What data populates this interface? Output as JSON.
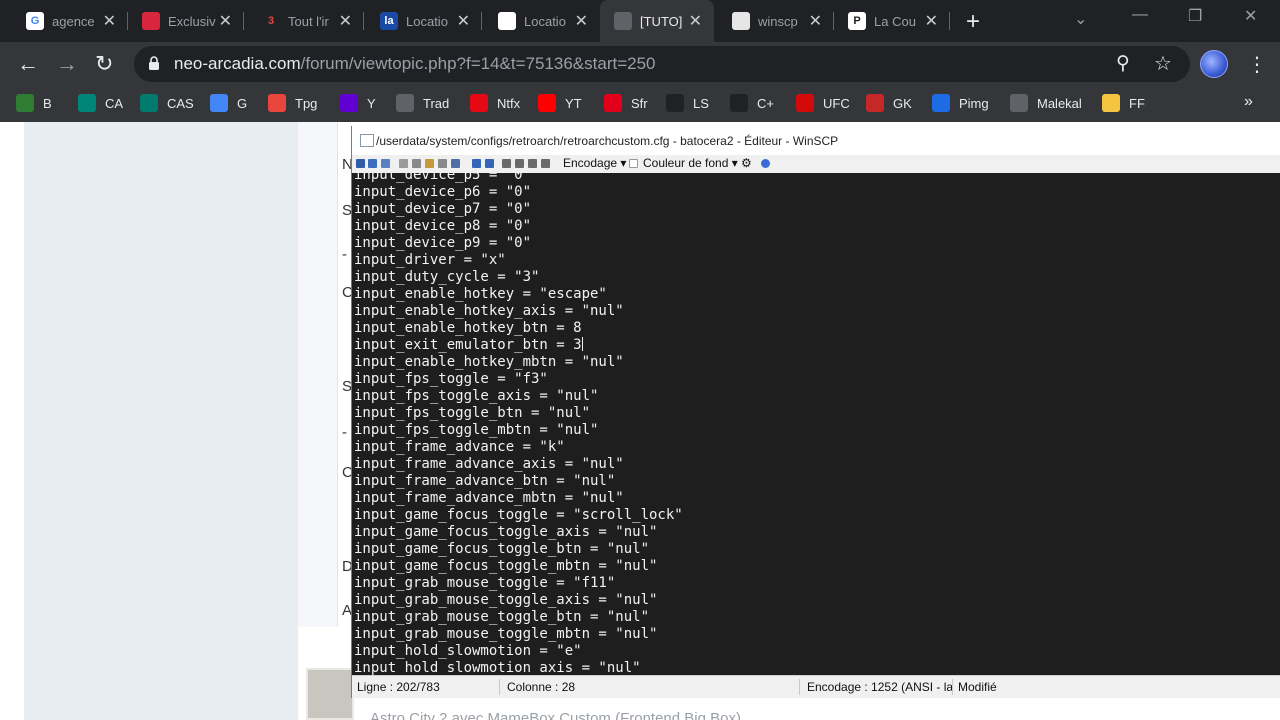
{
  "browser": {
    "tabs": [
      {
        "title": "agence",
        "favicon": "google-icon",
        "color": "#ffffff",
        "glyph": "G",
        "glyph_color": "#4285f4"
      },
      {
        "title": "Exclusiv",
        "favicon": "exclusiv-icon",
        "color": "#d9263f",
        "glyph": "",
        "glyph_color": "#ffffff"
      },
      {
        "title": "Tout l'ir",
        "favicon": "tout-icon",
        "color": "#202124",
        "glyph": "3",
        "glyph_color": "#e8453c"
      },
      {
        "title": "Locatio",
        "favicon": "lafayette-icon",
        "color": "#1a4aa6",
        "glyph": "la",
        "glyph_color": "#ffffff"
      },
      {
        "title": "Locatio",
        "favicon": "location-icon",
        "color": "#ffffff",
        "glyph": "",
        "glyph_color": "#e8453c"
      },
      {
        "title": "[TUTO]",
        "favicon": "globe-icon",
        "color": "#5f6368",
        "glyph": "",
        "glyph_color": "#e8eaed"
      },
      {
        "title": "winscp",
        "favicon": "winscp-icon",
        "color": "#e6e6e6",
        "glyph": "",
        "glyph_color": "#2c8a3a"
      },
      {
        "title": "La Cou",
        "favicon": "lacourse-icon",
        "color": "#ffffff",
        "glyph": "P",
        "glyph_color": "#202124"
      }
    ],
    "active_tab": 5,
    "url_host": "neo-arcadia.com",
    "url_path": "/forum/viewtopic.php?f=14&t=75136&start=250",
    "bookmarks": [
      {
        "label": "B",
        "icon": "headphones-icon",
        "color": "#2e7d32"
      },
      {
        "label": "CA",
        "icon": "ca-icon",
        "color": "#00857a"
      },
      {
        "label": "CAS",
        "icon": "cas-icon",
        "color": "#007a6e"
      },
      {
        "label": "G",
        "icon": "google-icon",
        "color": "#4285f4"
      },
      {
        "label": "Tpg",
        "icon": "tpg-icon",
        "color": "#e8453c"
      },
      {
        "label": "Y",
        "icon": "yahoo-icon",
        "color": "#6001d2"
      },
      {
        "label": "Trad",
        "icon": "globe-icon",
        "color": "#5f6368"
      },
      {
        "label": "Ntfx",
        "icon": "netflix-icon",
        "color": "#e50914"
      },
      {
        "label": "YT",
        "icon": "youtube-icon",
        "color": "#ff0000"
      },
      {
        "label": "Sfr",
        "icon": "sfr-icon",
        "color": "#e2001a"
      },
      {
        "label": "LS",
        "icon": "ls-icon",
        "color": "#202124"
      },
      {
        "label": "C+",
        "icon": "canalplus-icon",
        "color": "#202124"
      },
      {
        "label": "UFC",
        "icon": "ufc-icon",
        "color": "#d20a0a"
      },
      {
        "label": "GK",
        "icon": "gk-icon",
        "color": "#c62828"
      },
      {
        "label": "Pimg",
        "icon": "pimg-icon",
        "color": "#1e6be6"
      },
      {
        "label": "Malekal",
        "icon": "malekal-icon",
        "color": "#5f6368"
      },
      {
        "label": "FF",
        "icon": "folder-icon",
        "color": "#f5c542"
      }
    ]
  },
  "page": {
    "side_letters": [
      "N",
      "S",
      "-",
      "C",
      "S",
      "-",
      "C",
      "D",
      "A"
    ],
    "cut_text": "Astro City 2 avec MameBox Custom (Frontend Big Box)"
  },
  "editor": {
    "title": "/userdata/system/configs/retroarch/retroarchcustom.cfg - batocera2 - Éditeur - WinSCP",
    "toolbar": {
      "encoding_label": "Encodage",
      "bgcolor_label": "Couleur de fond"
    },
    "lines": [
      "input_device_p5 = \"0\"",
      "input_device_p6 = \"0\"",
      "input_device_p7 = \"0\"",
      "input_device_p8 = \"0\"",
      "input_device_p9 = \"0\"",
      "input_driver = \"x\"",
      "input_duty_cycle = \"3\"",
      "input_enable_hotkey = \"escape\"",
      "input_enable_hotkey_axis = \"nul\"",
      "input_enable_hotkey_btn = 8",
      "input_exit_emulator_btn = 3",
      "input_enable_hotkey_mbtn = \"nul\"",
      "input_fps_toggle = \"f3\"",
      "input_fps_toggle_axis = \"nul\"",
      "input_fps_toggle_btn = \"nul\"",
      "input_fps_toggle_mbtn = \"nul\"",
      "input_frame_advance = \"k\"",
      "input_frame_advance_axis = \"nul\"",
      "input_frame_advance_btn = \"nul\"",
      "input_frame_advance_mbtn = \"nul\"",
      "input_game_focus_toggle = \"scroll_lock\"",
      "input_game_focus_toggle_axis = \"nul\"",
      "input_game_focus_toggle_btn = \"nul\"",
      "input_game_focus_toggle_mbtn = \"nul\"",
      "input_grab_mouse_toggle = \"f11\"",
      "input_grab_mouse_toggle_axis = \"nul\"",
      "input_grab_mouse_toggle_btn = \"nul\"",
      "input_grab_mouse_toggle_mbtn = \"nul\"",
      "input_hold_slowmotion = \"e\"",
      "input_hold_slowmotion_axis = \"nul\""
    ],
    "caret_line": 10,
    "status": {
      "line": "Ligne : 202/783",
      "column": "Colonne : 28",
      "encoding": "Encodage : 1252  (ANSI - la",
      "modified": "Modifié"
    }
  }
}
